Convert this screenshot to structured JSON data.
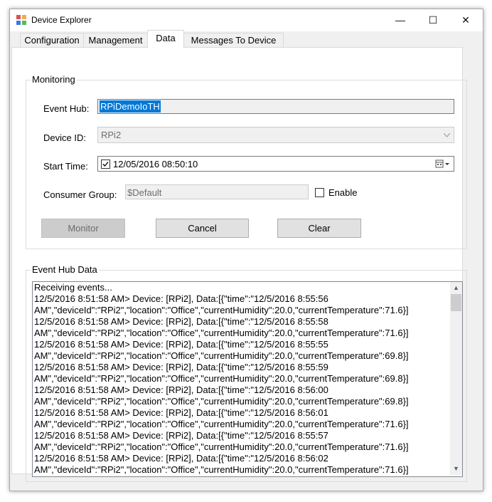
{
  "window": {
    "title": "Device Explorer",
    "minimize": "—",
    "maximize": "☐",
    "close": "✕"
  },
  "tabs": [
    {
      "label": "Configuration",
      "active": false
    },
    {
      "label": "Management",
      "active": false
    },
    {
      "label": "Data",
      "active": true
    },
    {
      "label": "Messages To Device",
      "active": false
    }
  ],
  "monitoring": {
    "group_title": "Monitoring",
    "event_hub_label": "Event Hub:",
    "event_hub_value": "RPiDemoIoTH",
    "device_id_label": "Device ID:",
    "device_id_value": "RPi2",
    "start_time_label": "Start Time:",
    "start_time_checked": true,
    "start_time_value": "12/05/2016 08:50:10",
    "consumer_group_label": "Consumer Group:",
    "consumer_group_value": "$Default",
    "enable_label": "Enable",
    "enable_checked": false,
    "monitor_button": "Monitor",
    "cancel_button": "Cancel",
    "clear_button": "Clear"
  },
  "event_hub_data": {
    "group_title": "Event Hub Data",
    "lines": [
      "Receiving events...",
      "12/5/2016 8:51:58 AM> Device: [RPi2], Data:[{\"time\":\"12/5/2016 8:55:56",
      "AM\",\"deviceId\":\"RPi2\",\"location\":\"Office\",\"currentHumidity\":20.0,\"currentTemperature\":71.6}]",
      "12/5/2016 8:51:58 AM> Device: [RPi2], Data:[{\"time\":\"12/5/2016 8:55:58",
      "AM\",\"deviceId\":\"RPi2\",\"location\":\"Office\",\"currentHumidity\":20.0,\"currentTemperature\":71.6}]",
      "12/5/2016 8:51:58 AM> Device: [RPi2], Data:[{\"time\":\"12/5/2016 8:55:55",
      "AM\",\"deviceId\":\"RPi2\",\"location\":\"Office\",\"currentHumidity\":20.0,\"currentTemperature\":69.8}]",
      "12/5/2016 8:51:58 AM> Device: [RPi2], Data:[{\"time\":\"12/5/2016 8:55:59",
      "AM\",\"deviceId\":\"RPi2\",\"location\":\"Office\",\"currentHumidity\":20.0,\"currentTemperature\":69.8}]",
      "12/5/2016 8:51:58 AM> Device: [RPi2], Data:[{\"time\":\"12/5/2016 8:56:00",
      "AM\",\"deviceId\":\"RPi2\",\"location\":\"Office\",\"currentHumidity\":20.0,\"currentTemperature\":69.8}]",
      "12/5/2016 8:51:58 AM> Device: [RPi2], Data:[{\"time\":\"12/5/2016 8:56:01",
      "AM\",\"deviceId\":\"RPi2\",\"location\":\"Office\",\"currentHumidity\":20.0,\"currentTemperature\":71.6}]",
      "12/5/2016 8:51:58 AM> Device: [RPi2], Data:[{\"time\":\"12/5/2016 8:55:57",
      "AM\",\"deviceId\":\"RPi2\",\"location\":\"Office\",\"currentHumidity\":20.0,\"currentTemperature\":71.6}]",
      "12/5/2016 8:51:58 AM> Device: [RPi2], Data:[{\"time\":\"12/5/2016 8:56:02",
      "AM\",\"deviceId\":\"RPi2\",\"location\":\"Office\",\"currentHumidity\":20.0,\"currentTemperature\":71.6}]"
    ]
  },
  "colors": {
    "selection": "#0078d7",
    "window_bg": "#f0f0f0",
    "disabled_text": "#6d6d6d"
  }
}
